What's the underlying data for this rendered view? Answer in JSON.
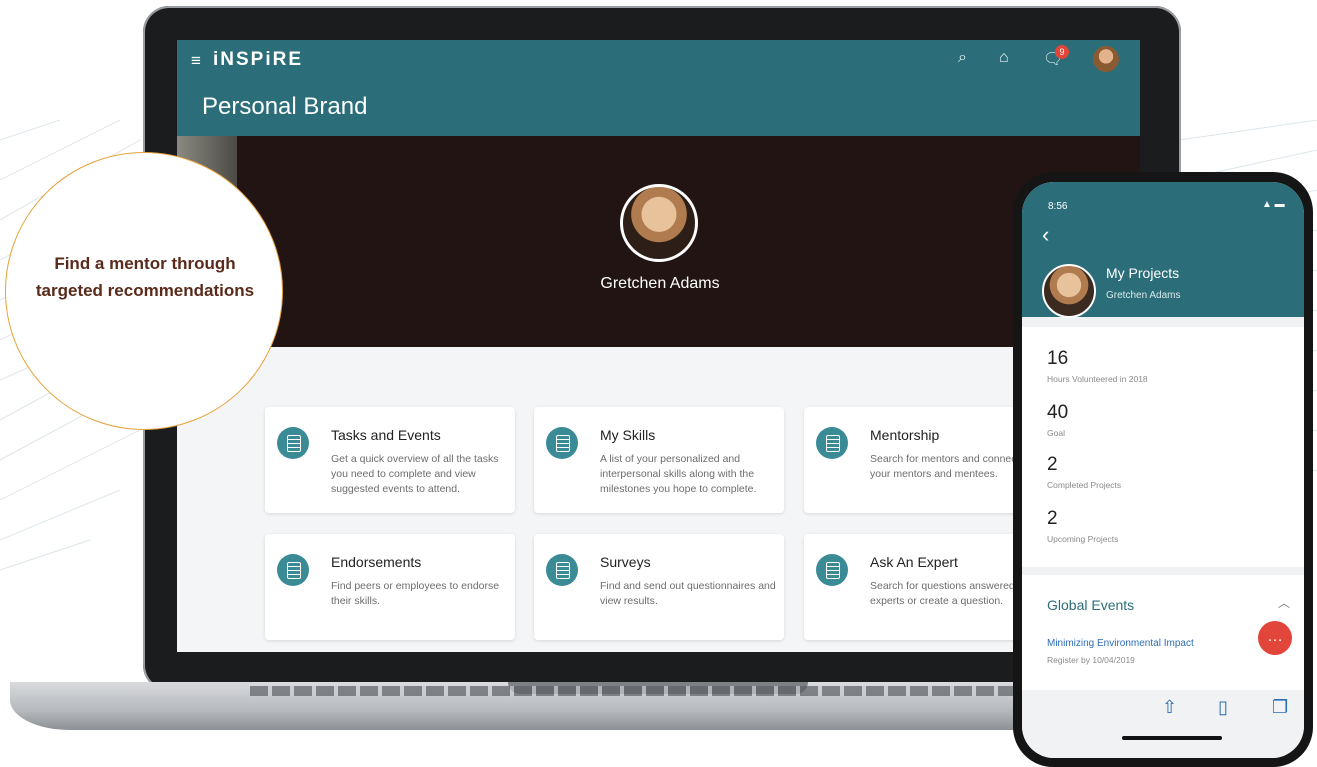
{
  "app": {
    "logo": "iNSPiRE",
    "page_title": "Personal Brand",
    "notification_count": "9",
    "icons": [
      "menu-icon",
      "search-icon",
      "home-icon",
      "notification-icon",
      "avatar"
    ]
  },
  "profile": {
    "name": "Gretchen Adams"
  },
  "cards": [
    {
      "title": "Tasks and Events",
      "desc": "Get a quick overview of all the tasks you need to complete and view suggested events to attend."
    },
    {
      "title": "My Skills",
      "desc": "A list of your personalized and interpersonal skills along with the milestones you hope to complete."
    },
    {
      "title": "Mentorship",
      "desc": "Search for mentors and connect with your mentors and mentees."
    },
    {
      "title": "Endorsements",
      "desc": "Find peers or employees to endorse their skills."
    },
    {
      "title": "Surveys",
      "desc": "Find and send out questionnaires and view results."
    },
    {
      "title": "Ask An Expert",
      "desc": "Search for questions answered by experts or create a question."
    }
  ],
  "callout": {
    "text": "Find a mentor through targeted recommendations"
  },
  "phone": {
    "time": "8:56",
    "title": "My Projects",
    "subtitle": "Gretchen Adams",
    "stats": [
      {
        "value": "16",
        "label": "Hours Volunteered in 2018"
      },
      {
        "value": "40",
        "label": "Goal"
      },
      {
        "value": "2",
        "label": "Completed Projects"
      },
      {
        "value": "2",
        "label": "Upcoming Projects"
      }
    ],
    "events": {
      "title": "Global Events",
      "item_title": "Minimizing Environmental Impact",
      "item_date": "Register by 10/04/2019"
    }
  },
  "colors": {
    "brand": "#2b6e7a",
    "accent": "#e2463a",
    "callout_border": "#e6a13a"
  }
}
